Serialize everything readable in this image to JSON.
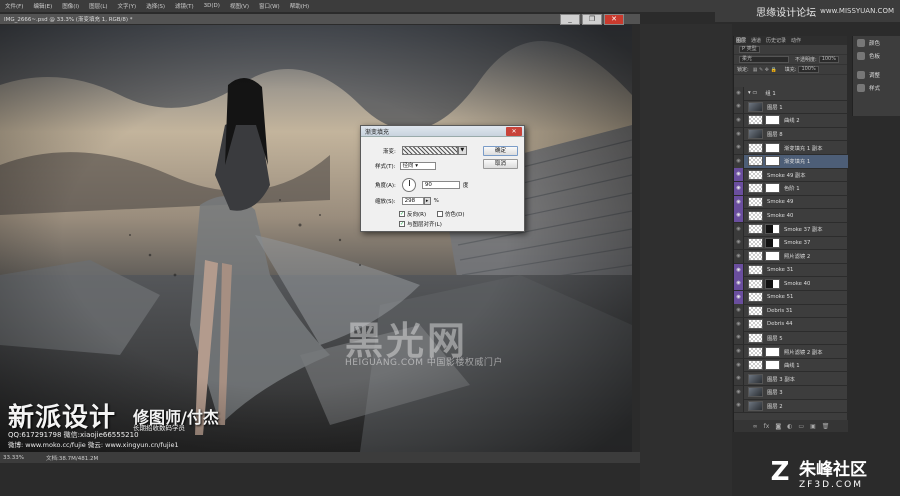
{
  "menubar": [
    "文件(F)",
    "编辑(E)",
    "图像(I)",
    "图层(L)",
    "文字(Y)",
    "选择(S)",
    "滤镜(T)",
    "3D(D)",
    "视图(V)",
    "窗口(W)",
    "帮助(H)"
  ],
  "site_header": {
    "cn": "思缘设计论坛",
    "en": "www.MISSYUAN.COM"
  },
  "document": {
    "tab_title": "IMG_2666~.psd @ 33.3% (渐变填充 1, RGB/8) *",
    "zoom": "33.33%",
    "doc_size": "文档:38.7M/481.2M"
  },
  "window_controls": {
    "minimize": "_",
    "restore": "❐",
    "close": "✕"
  },
  "overlay": {
    "brand_big": "新派设计",
    "brand_role": "修图师/付杰",
    "brand_sub": "长期招收数码学员",
    "qq_line": "QQ:617291798  微信:xiaojie66555210",
    "weibo_line": "微博: www.moko.cc/fujie   微云: www.xingyun.cn/fujie1",
    "watermark": "黑光网",
    "watermark_sub": "HEIGUANG.COM 中国影楼权威门户"
  },
  "dialog": {
    "title": "渐变填充",
    "close": "✕",
    "gradient_label": "渐变:",
    "style_label": "样式(T):",
    "style_value": "径向",
    "angle_label": "角度(A):",
    "angle_value": "90",
    "angle_unit": "度",
    "scale_label": "缩放(S):",
    "scale_value": "298",
    "scale_unit": "%",
    "reverse_label": "反向(R)",
    "dither_label": "仿色(D)",
    "align_label": "与图层对齐(L)",
    "ok": "确定",
    "cancel": "取消",
    "reverse_checked": true,
    "dither_checked": false,
    "align_checked": true
  },
  "layers_panel": {
    "tabs": [
      "图层",
      "通道",
      "历史记录",
      "动作"
    ],
    "kind_label": "P 类型",
    "blend_mode": "柔光",
    "opacity_label": "不透明度:",
    "opacity_value": "100%",
    "lock_label": "锁定:",
    "fill_label": "填充:",
    "fill_value": "100%",
    "layers": [
      {
        "name": "组 1",
        "kind": "group",
        "purple": false
      },
      {
        "name": "图层 1",
        "kind": "image",
        "purple": false
      },
      {
        "name": "曲线 2",
        "kind": "adj",
        "purple": false
      },
      {
        "name": "图层 8",
        "kind": "image",
        "purple": false
      },
      {
        "name": "渐变填充 1 副本",
        "kind": "adj",
        "purple": false
      },
      {
        "name": "渐变填充 1",
        "kind": "adj",
        "purple": false,
        "selected": true
      },
      {
        "name": "Smoke 49 副本",
        "kind": "blank",
        "purple": true
      },
      {
        "name": "色阶 1",
        "kind": "adj",
        "purple": true
      },
      {
        "name": "Smoke 49",
        "kind": "blank",
        "purple": true
      },
      {
        "name": "Smoke 40",
        "kind": "blank",
        "purple": true
      },
      {
        "name": "Smoke 37 副本",
        "kind": "mask",
        "purple": false
      },
      {
        "name": "Smoke 37",
        "kind": "mask",
        "purple": false
      },
      {
        "name": "照片滤镜 2",
        "kind": "adj",
        "purple": false
      },
      {
        "name": "Smoke 31",
        "kind": "blank",
        "purple": true
      },
      {
        "name": "Smoke 40",
        "kind": "mask",
        "purple": true
      },
      {
        "name": "Smoke 51",
        "kind": "blank",
        "purple": true
      },
      {
        "name": "Debris 31",
        "kind": "blank",
        "purple": false
      },
      {
        "name": "Debris 44",
        "kind": "blank",
        "purple": false
      },
      {
        "name": "图层 5",
        "kind": "blank",
        "purple": false
      },
      {
        "name": "照片滤镜 2 副本",
        "kind": "adj",
        "purple": false
      },
      {
        "name": "曲线 1",
        "kind": "adj",
        "purple": false
      },
      {
        "name": "图层 3 副本",
        "kind": "image",
        "purple": false
      },
      {
        "name": "图层 3",
        "kind": "image",
        "purple": false
      },
      {
        "name": "图层 2",
        "kind": "image",
        "purple": false
      }
    ],
    "footer_icons": [
      "link-icon",
      "fx-icon",
      "mask-icon",
      "adjustment-icon",
      "folder-icon",
      "new-layer-icon",
      "trash-icon"
    ]
  },
  "side_panels": [
    {
      "label": "颜色",
      "icon": "color-icon"
    },
    {
      "label": "色板",
      "icon": "swatches-icon"
    },
    {
      "label": "调整",
      "icon": "adjustments-icon"
    },
    {
      "label": "样式",
      "icon": "styles-icon"
    }
  ],
  "corner_logo": {
    "cn": "朱峰社区",
    "domain": "ZF3D.COM"
  }
}
